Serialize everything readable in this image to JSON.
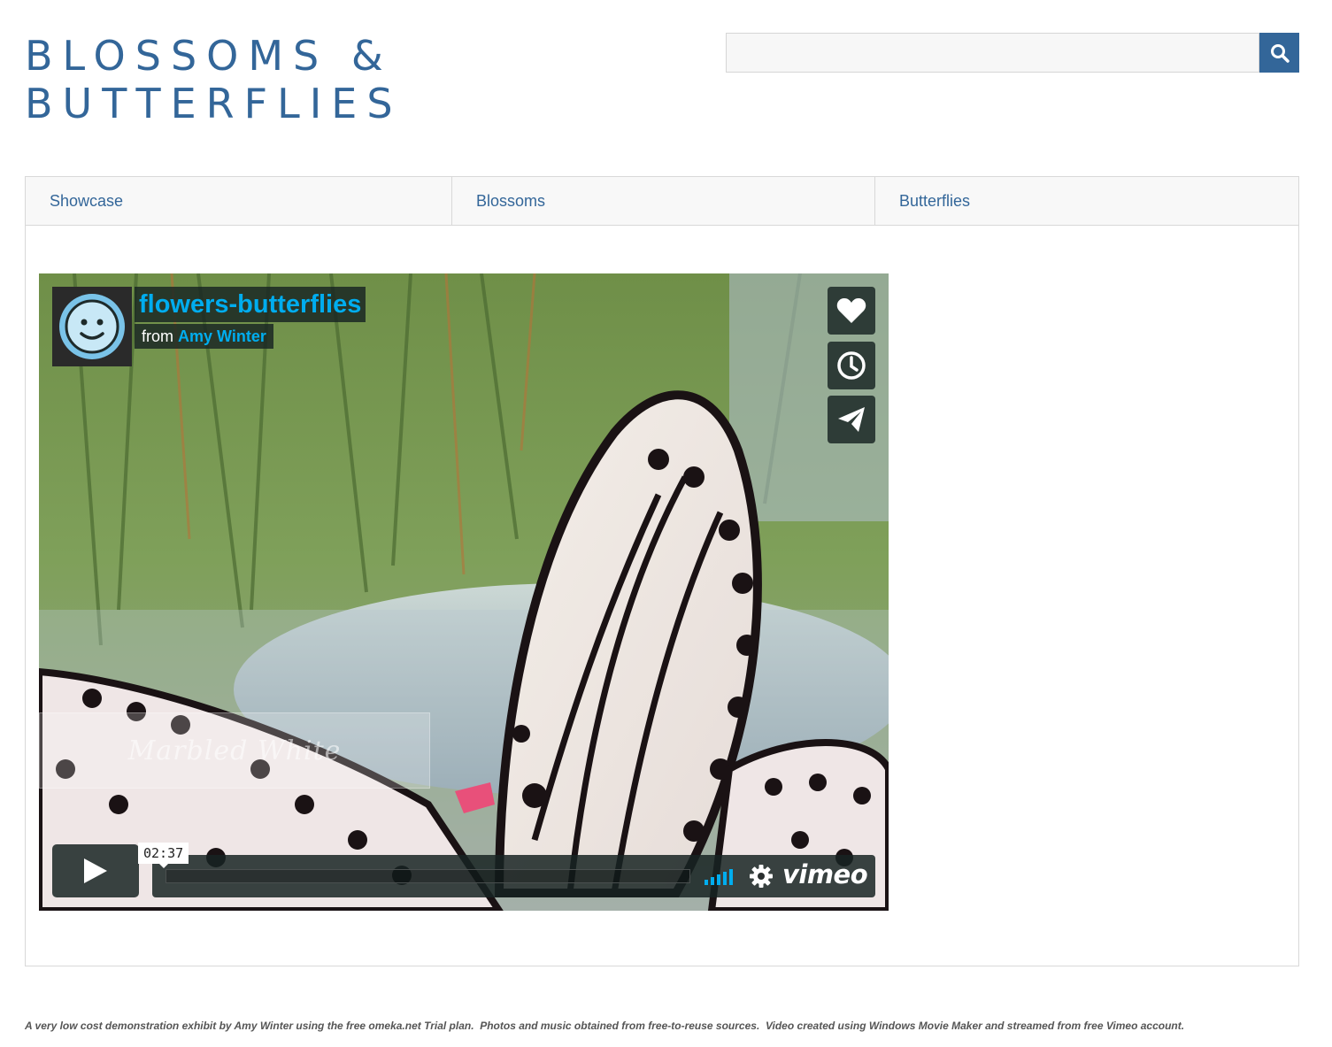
{
  "header": {
    "title_line1": "BLOSSOMS &",
    "title_line2": "BUTTERFLIES"
  },
  "search": {
    "value": "",
    "placeholder": "",
    "button_icon": "search-icon"
  },
  "nav": {
    "items": [
      {
        "label": "Showcase"
      },
      {
        "label": "Blossoms"
      },
      {
        "label": "Butterflies"
      }
    ]
  },
  "video": {
    "title": "flowers-butterflies",
    "byline_prefix": "from",
    "author": "Amy Winter",
    "caption": "Marbled White",
    "timecode": "02:37",
    "brand": "vimeo",
    "side_buttons": [
      "like-icon",
      "watch-later-icon",
      "share-icon"
    ],
    "playback_progress": 0
  },
  "footer": {
    "text": "A very low cost demonstration exhibit by Amy Winter using the free omeka.net Trial plan.  Photos and music obtained from free-to-reuse sources.  Video created using Windows Movie Maker and streamed from free Vimeo account."
  },
  "colors": {
    "brand_blue": "#336699",
    "vimeo_blue": "#00adef"
  }
}
